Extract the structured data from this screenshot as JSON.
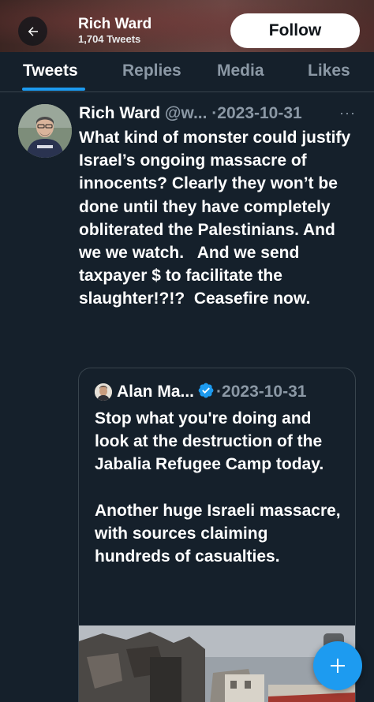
{
  "header": {
    "title": "Rich Ward",
    "subtitle": "1,704 Tweets",
    "follow_label": "Follow",
    "back_icon": "back-arrow-icon"
  },
  "tabs": [
    {
      "label": "Tweets",
      "active": true
    },
    {
      "label": "Replies",
      "active": false
    },
    {
      "label": "Media",
      "active": false
    },
    {
      "label": "Likes",
      "active": false
    }
  ],
  "tweet": {
    "name": "Rich Ward",
    "handle": "@w...",
    "separator": "·",
    "date": "2023-10-31",
    "more": "···",
    "text": "What kind of monster could justify Israel’s ongoing massacre of innocents? Clearly they won’t be done until they have completely obliterated the Palestinians. And we we watch.   And we send taxpayer $ to facilitate the slaughter!?!?  Ceasefire now."
  },
  "quote": {
    "name": "Alan Ma...",
    "separator": "·",
    "date": "2023-10-31",
    "text": "Stop what you're doing and look at the destruction of the Jabalia Refugee Camp today.\n\nAnother huge Israeli massacre, with sources claiming hundreds of casualties."
  },
  "colors": {
    "background": "#15202b",
    "accent": "#1d9bf0",
    "muted": "#8b98a5"
  }
}
